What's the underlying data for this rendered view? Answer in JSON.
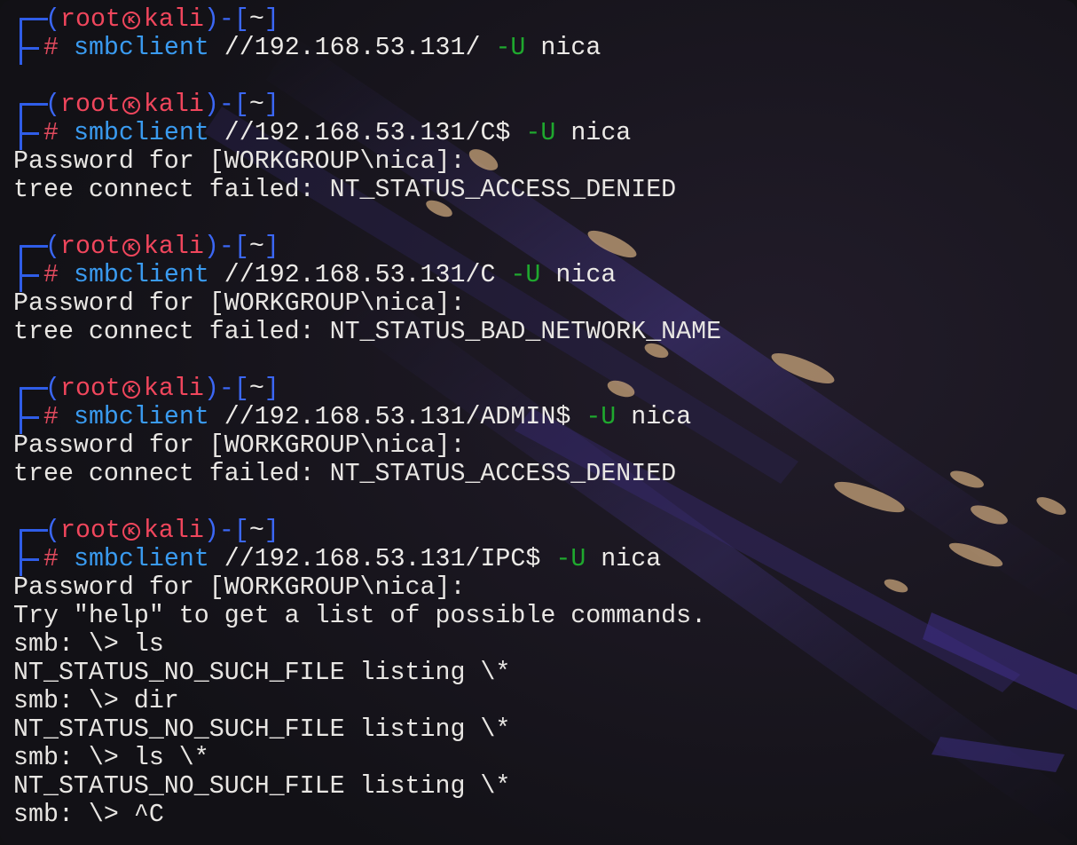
{
  "prompt": {
    "user": "root",
    "host": "kali",
    "dir": "~",
    "hash": "#",
    "skull_icon": "kali-skull-icon"
  },
  "colors": {
    "frame": "#2f5de8",
    "user_host": "#f0465c",
    "command": "#3a9bf0",
    "flag": "#1fa82e",
    "text": "#e8e6e3",
    "background": "#141319"
  },
  "blocks": [
    {
      "cmd": "smbclient",
      "target": " //192.168.53.131/ ",
      "flag": "-U",
      "arg": " nica",
      "output": []
    },
    {
      "cmd": "smbclient",
      "target": " //192.168.53.131/C$ ",
      "flag": "-U",
      "arg": " nica",
      "output": [
        "Password for [WORKGROUP\\nica]:",
        "tree connect failed: NT_STATUS_ACCESS_DENIED"
      ]
    },
    {
      "cmd": "smbclient",
      "target": " //192.168.53.131/C ",
      "flag": "-U",
      "arg": " nica",
      "output": [
        "Password for [WORKGROUP\\nica]:",
        "tree connect failed: NT_STATUS_BAD_NETWORK_NAME"
      ]
    },
    {
      "cmd": "smbclient",
      "target": " //192.168.53.131/ADMIN$ ",
      "flag": "-U",
      "arg": " nica",
      "output": [
        "Password for [WORKGROUP\\nica]:",
        "tree connect failed: NT_STATUS_ACCESS_DENIED"
      ]
    },
    {
      "cmd": "smbclient",
      "target": " //192.168.53.131/IPC$ ",
      "flag": "-U",
      "arg": " nica",
      "output": [
        "Password for [WORKGROUP\\nica]:",
        "Try \"help\" to get a list of possible commands.",
        "smb: \\> ls",
        "NT_STATUS_NO_SUCH_FILE listing \\*",
        "smb: \\> dir",
        "NT_STATUS_NO_SUCH_FILE listing \\*",
        "smb: \\> ls \\*",
        "NT_STATUS_NO_SUCH_FILE listing \\*",
        "smb: \\> ^C"
      ]
    }
  ]
}
